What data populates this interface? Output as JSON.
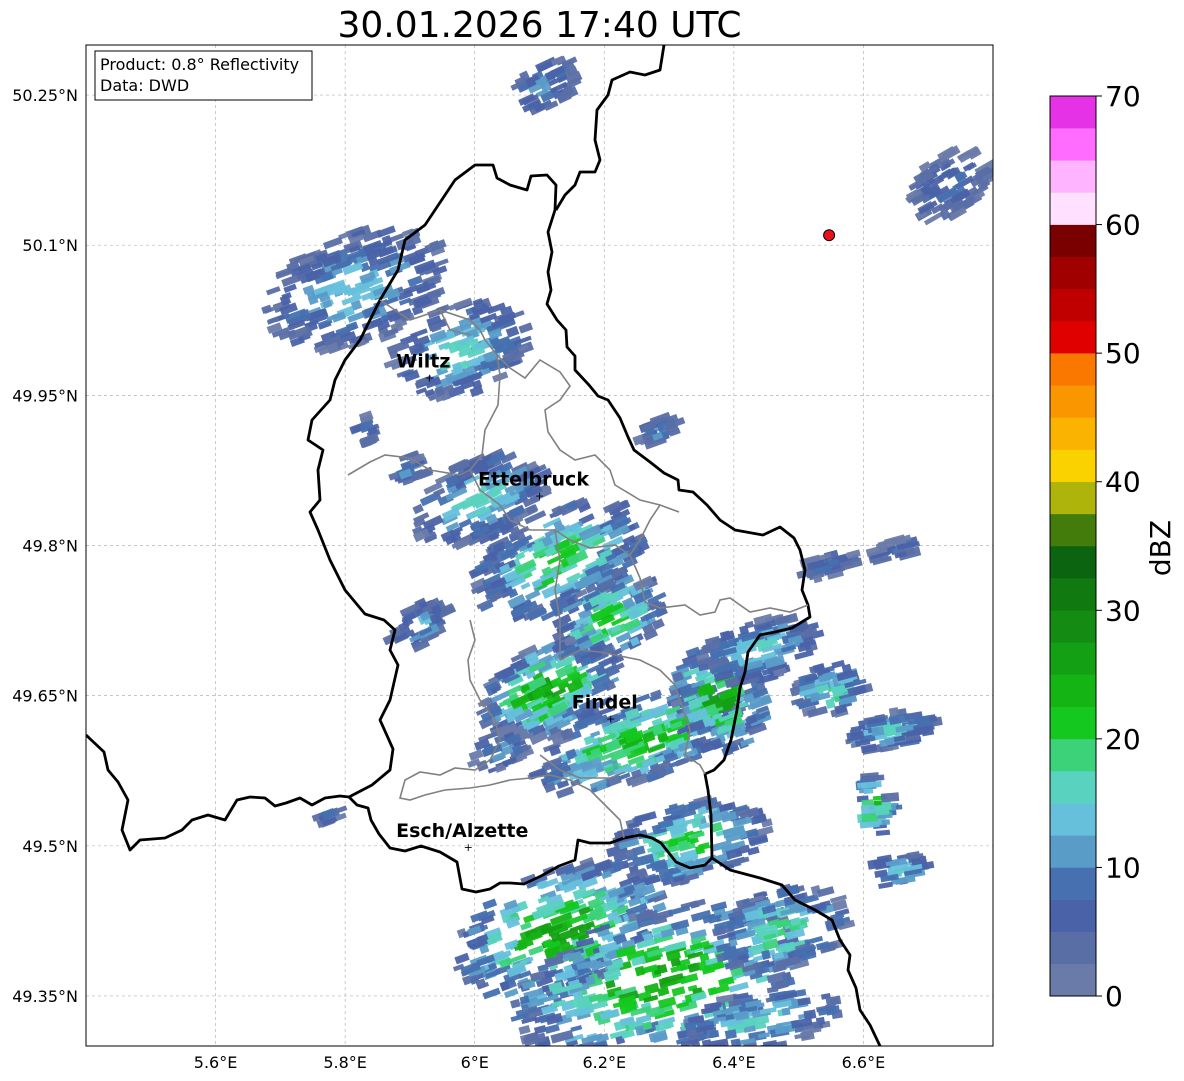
{
  "title": "30.01.2026 17:40 UTC",
  "info_box": {
    "product": "Product: 0.8° Reflectivity",
    "data": "Data: DWD"
  },
  "map": {
    "lon_range": [
      5.4,
      6.8
    ],
    "lat_range": [
      49.3,
      50.3
    ],
    "lon_ticks": [
      "5.6°E",
      "5.8°E",
      "6°E",
      "6.2°E",
      "6.4°E",
      "6.6°E"
    ],
    "lat_ticks": [
      "50.25°N",
      "50.1°N",
      "49.95°N",
      "49.8°N",
      "49.65°N",
      "49.5°N",
      "49.35°N"
    ],
    "grid": true,
    "cities": [
      {
        "name": "Wiltz",
        "lon": 5.93,
        "lat": 49.968
      },
      {
        "name": "Ettelbruck",
        "lon": 6.1,
        "lat": 49.85
      },
      {
        "name": "Findel",
        "lon": 6.21,
        "lat": 49.627
      },
      {
        "name": "Esch/Alzette",
        "lon": 5.99,
        "lat": 49.499
      }
    ],
    "radar_site": {
      "lon": 6.547,
      "lat": 50.11,
      "color": "#e8121a"
    },
    "border_color": "#000000",
    "canton_color": "#808080"
  },
  "colorbar": {
    "label": "dBZ",
    "ticks": [
      "0",
      "10",
      "20",
      "30",
      "40",
      "50",
      "60",
      "70"
    ],
    "colors": [
      "#6a7baa",
      "#5a6ea6",
      "#4a62a8",
      "#4670b0",
      "#5a9cc8",
      "#66c0dc",
      "#5ad2c0",
      "#3cd27a",
      "#14c820",
      "#14b414",
      "#14a014",
      "#148c14",
      "#107a10",
      "#0a6410",
      "#437c0a",
      "#afb40a",
      "#fad200",
      "#fab400",
      "#fa9600",
      "#fa7800",
      "#e00000",
      "#c00000",
      "#a00000",
      "#7a0000",
      "#ffe0ff",
      "#ffb4ff",
      "#ff6cff",
      "#e632e6"
    ]
  }
}
